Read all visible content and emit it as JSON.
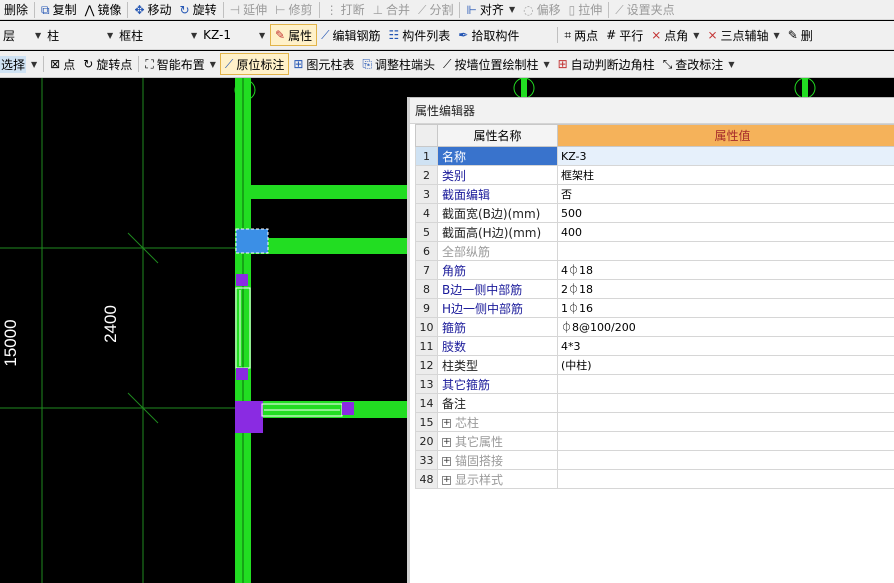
{
  "toolbar1": {
    "delete": "删除",
    "copy": "复制",
    "mirror": "镜像",
    "move": "移动",
    "rotate": "旋转",
    "extend": "延伸",
    "trim": "修剪",
    "break": "打断",
    "merge": "合并",
    "split": "分割",
    "align": "对齐",
    "offset": "偏移",
    "stretch": "拉伸",
    "set_pinch_point": "设置夹点"
  },
  "toolbar2": {
    "floor_combo": "层",
    "type_combo": "柱",
    "subtype_combo": "框柱",
    "component_combo": "KZ-1",
    "attributes": "属性",
    "edit_rebar": "编辑钢筋",
    "component_list": "构件列表",
    "pick_component": "拾取构件",
    "two_points": "两点",
    "parallel": "平行",
    "point_angle": "点角",
    "three_point_aux": "三点辅轴",
    "delete_aux": "删"
  },
  "toolbar3": {
    "select": "选择",
    "point": "点",
    "rotate_point": "旋转点",
    "smart_layout": "智能布置",
    "in_situ_mark": "原位标注",
    "drawing_column_table": "图元柱表",
    "adjust_column_end": "调整柱端头",
    "draw_by_wall": "按墙位置绘制柱",
    "auto_corner_column": "自动判断边角柱",
    "modify_mark": "查改标注"
  },
  "canvas": {
    "axis_labels": [
      "15000",
      "2400"
    ],
    "colors": {
      "background": "#000000",
      "column_green": "#22dd22",
      "grid_line": "#1f8a1f",
      "selection_blue": "#3b8fe6",
      "marker_purple": "#8a2be2"
    }
  },
  "property_editor": {
    "title": "属性编辑器",
    "header_name": "属性名称",
    "header_value": "属性值",
    "rows": [
      {
        "num": "1",
        "name": "名称",
        "value": "KZ-3"
      },
      {
        "num": "2",
        "name": "类别",
        "value": "框架柱"
      },
      {
        "num": "3",
        "name": "截面编辑",
        "value": "否"
      },
      {
        "num": "4",
        "name": "截面宽(B边)(mm)",
        "value": "500"
      },
      {
        "num": "5",
        "name": "截面高(H边)(mm)",
        "value": "400"
      },
      {
        "num": "6",
        "name": "全部纵筋",
        "value": ""
      },
      {
        "num": "7",
        "name": "角筋",
        "value": "4⏀18"
      },
      {
        "num": "8",
        "name": "B边一侧中部筋",
        "value": "2⏀18"
      },
      {
        "num": "9",
        "name": "H边一侧中部筋",
        "value": "1⏀16"
      },
      {
        "num": "10",
        "name": "箍筋",
        "value": "⏀8@100/200"
      },
      {
        "num": "11",
        "name": "肢数",
        "value": "4*3"
      },
      {
        "num": "12",
        "name": "柱类型",
        "value": "(中柱)"
      },
      {
        "num": "13",
        "name": "其它箍筋",
        "value": ""
      },
      {
        "num": "14",
        "name": "备注",
        "value": ""
      },
      {
        "num": "15",
        "name": "芯柱",
        "value": ""
      },
      {
        "num": "20",
        "name": "其它属性",
        "value": ""
      },
      {
        "num": "33",
        "name": "锚固搭接",
        "value": ""
      },
      {
        "num": "48",
        "name": "显示样式",
        "value": ""
      }
    ]
  }
}
